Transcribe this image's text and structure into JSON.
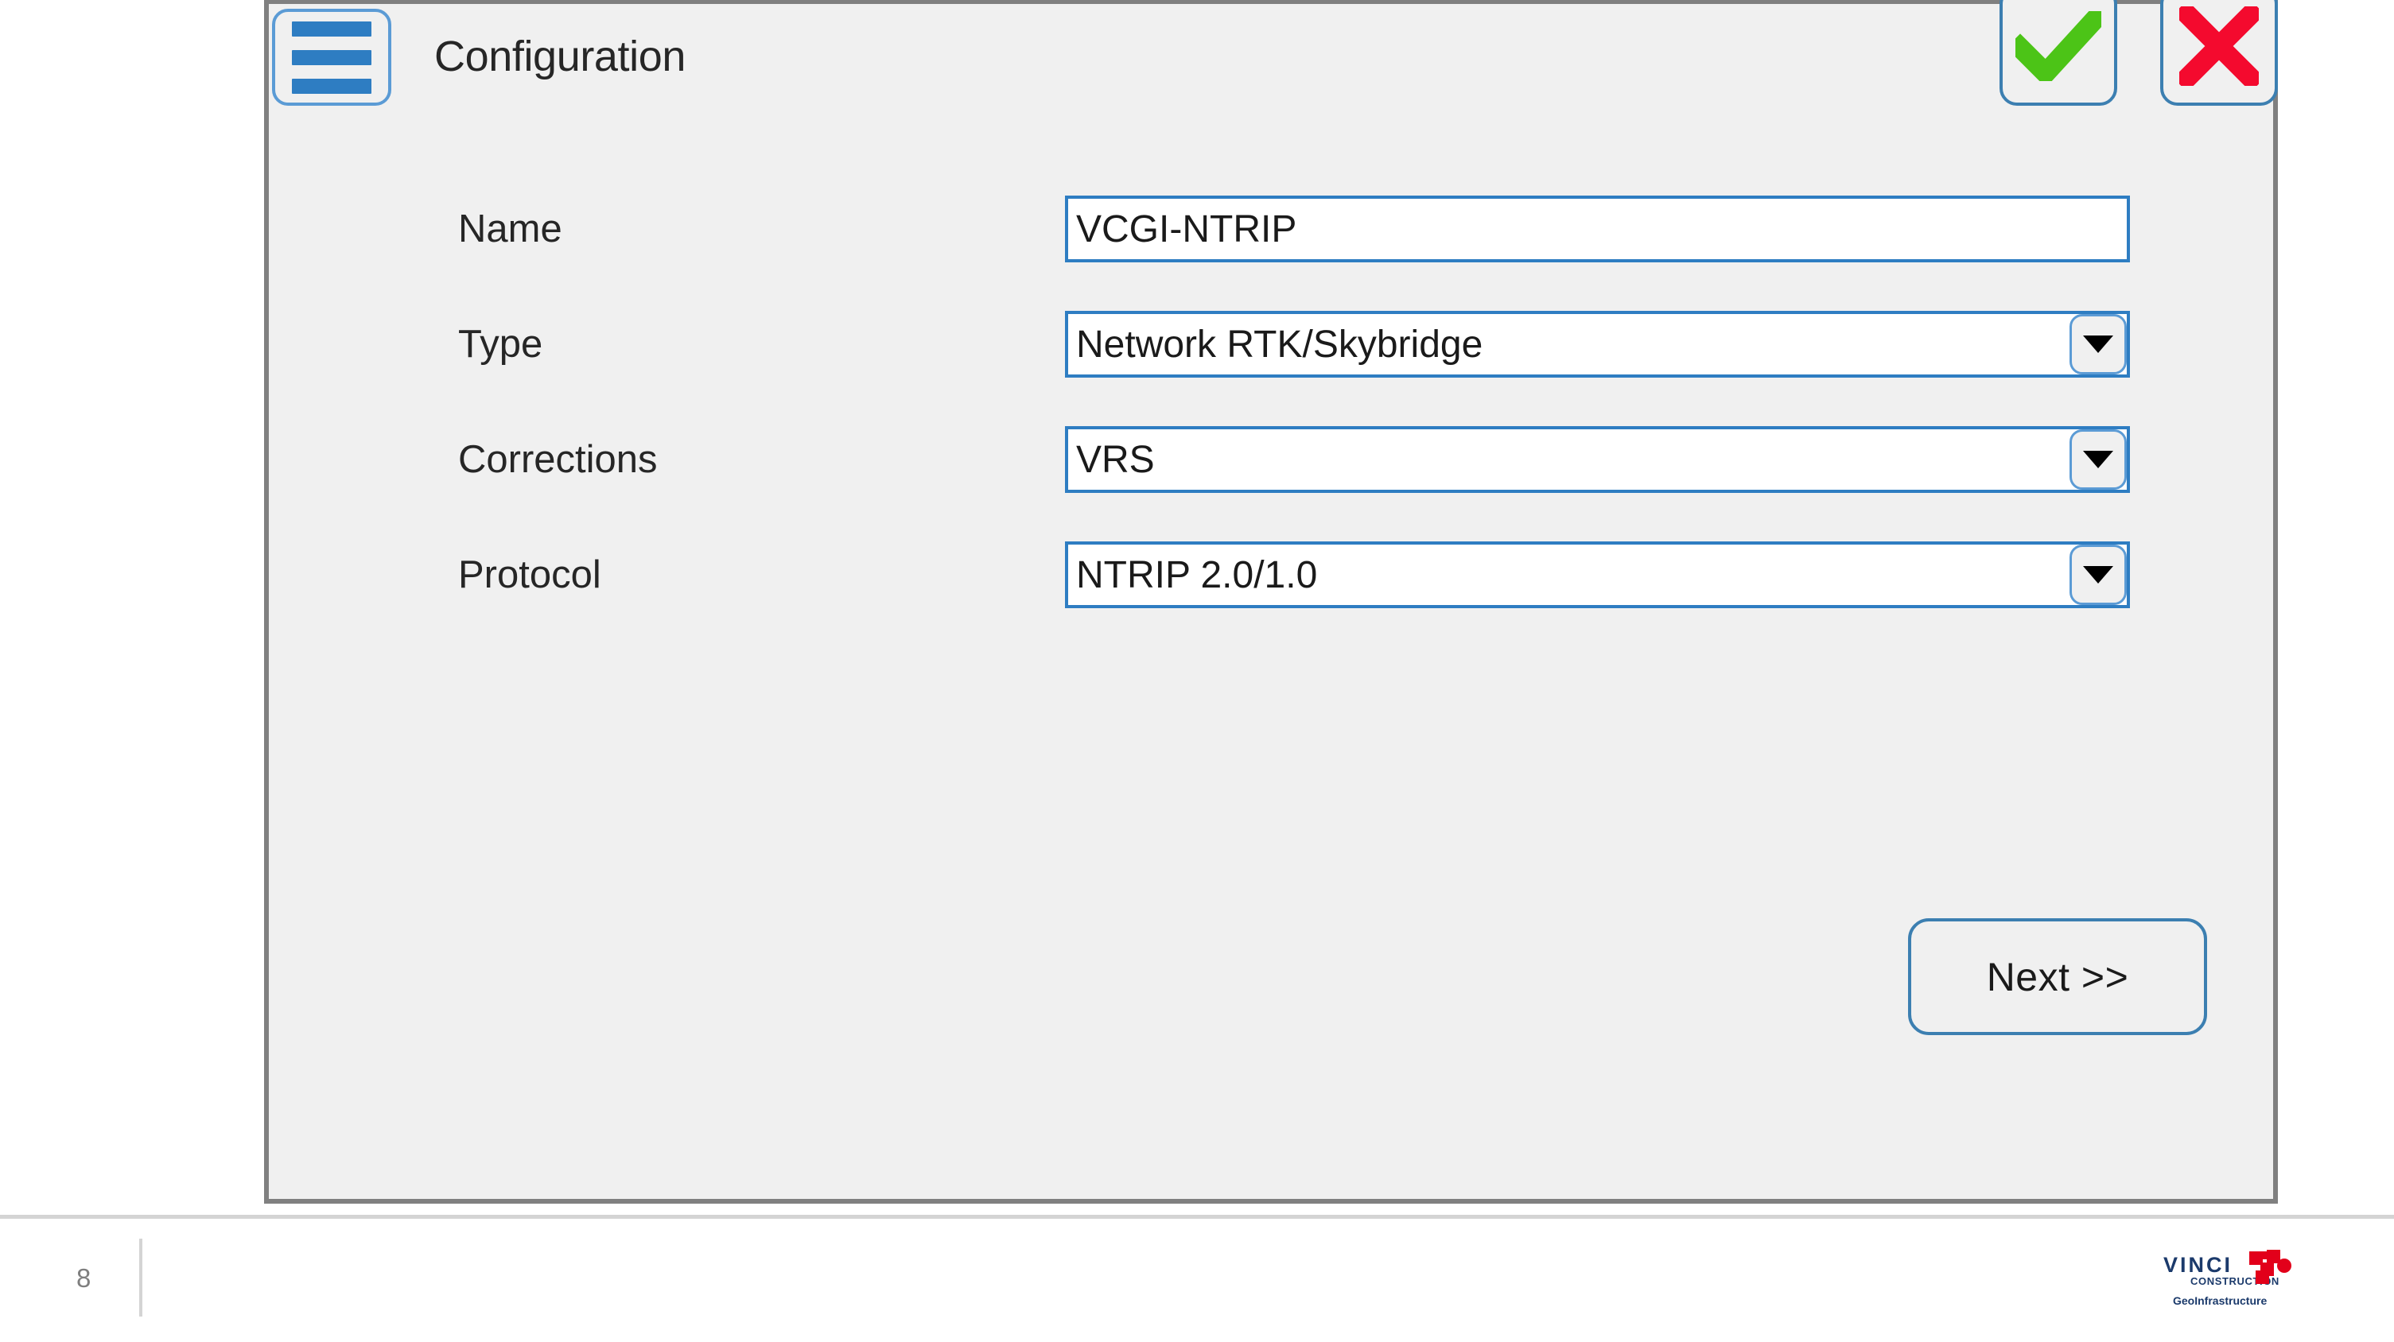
{
  "dialog": {
    "title": "Configuration",
    "menu_icon": "hamburger-menu-icon",
    "accept_icon": "green-check-icon",
    "cancel_icon": "red-x-icon",
    "accept_color": "#4CC417",
    "cancel_color": "#F40A2E",
    "fields": [
      {
        "label": "Name",
        "value": "VCGI-NTRIP",
        "control": "text",
        "name": "name-field"
      },
      {
        "label": "Type",
        "value": "Network RTK/Skybridge",
        "control": "dropdown",
        "name": "type-dropdown"
      },
      {
        "label": "Corrections",
        "value": "VRS",
        "control": "dropdown",
        "name": "corrections-dropdown"
      },
      {
        "label": "Protocol",
        "value": "NTRIP 2.0/1.0",
        "control": "dropdown",
        "name": "protocol-dropdown"
      }
    ],
    "next_button": "Next >>"
  },
  "footer": {
    "page_number": "8",
    "logo": {
      "wordmark": "VINCI",
      "subtitle": "CONSTRUCTION",
      "tagline": "GeoInfrastructure",
      "brand_color": "#1B3A6B",
      "mark_color": "#E2001A"
    }
  }
}
